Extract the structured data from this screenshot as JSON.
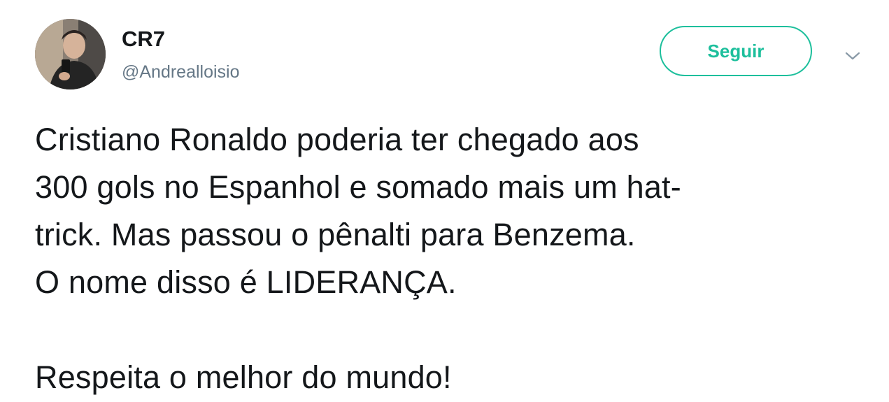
{
  "user": {
    "display_name": "CR7",
    "handle": "@Andrealloisio"
  },
  "actions": {
    "follow_label": "Seguir",
    "menu_icon": "chevron-down-icon"
  },
  "tweet": {
    "lines": [
      "Cristiano Ronaldo poderia ter chegado aos",
      "300 gols no Espanhol e somado mais um hat-",
      "trick. Mas passou o pênalti para Benzema.",
      "O nome disso é LIDERANÇA.",
      "Respeita o melhor do mundo!"
    ]
  },
  "colors": {
    "accent": "#1dbf9c",
    "text": "#14171a",
    "secondary": "#657786"
  }
}
